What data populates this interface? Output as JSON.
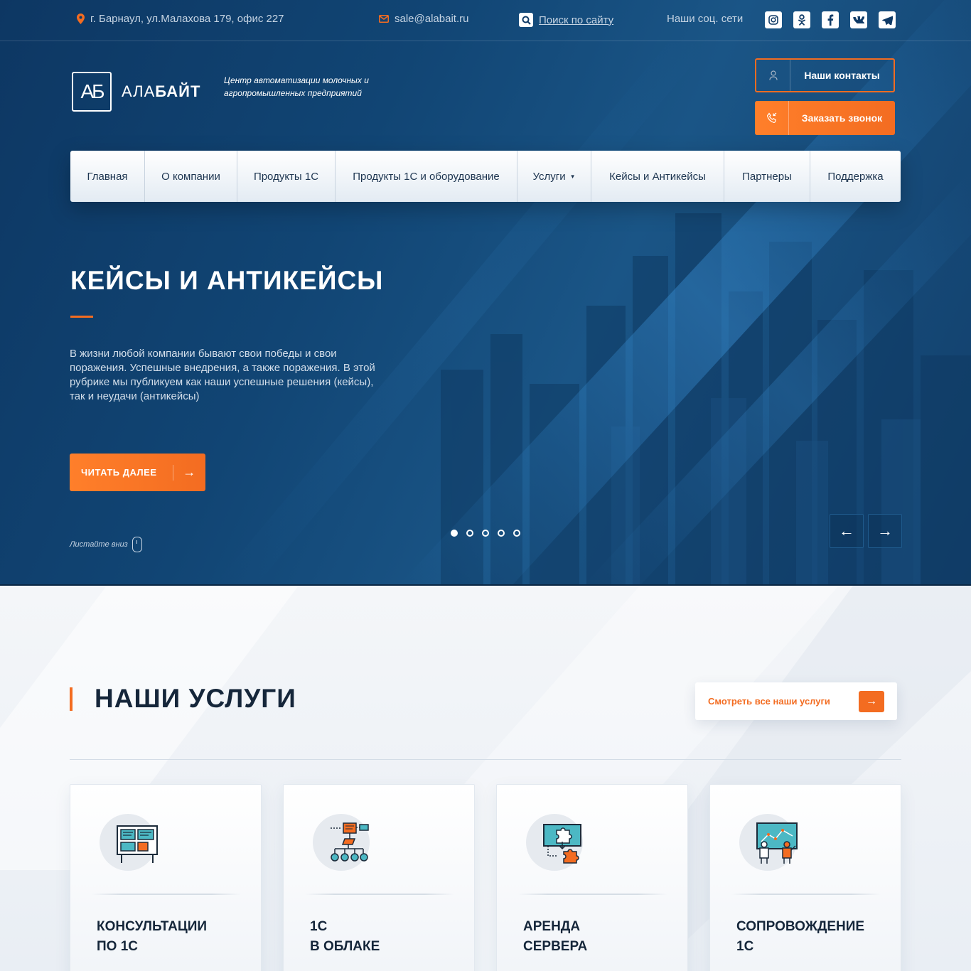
{
  "topbar": {
    "address": "г. Барнаул, ул.Малахова 179, офис 227",
    "email": "sale@alabait.ru",
    "search_link": "Поиск по сайту",
    "social_label": "Наши соц. сети",
    "socials": [
      "instagram-icon",
      "odnoklassniki-icon",
      "facebook-icon",
      "vk-icon",
      "telegram-icon"
    ]
  },
  "header": {
    "logo_mark": "АБ",
    "logo_light": "АЛА",
    "logo_bold": "БАЙТ",
    "tagline": "Центр автоматизации молочных и агропромышленных предприятий",
    "contacts_button": "Наши контакты",
    "call_button": "Заказать звонок"
  },
  "nav": {
    "items": [
      {
        "label": "Главная"
      },
      {
        "label": "О компании"
      },
      {
        "label": "Продукты 1С"
      },
      {
        "label": "Продукты 1С и оборудование"
      },
      {
        "label": "Услуги"
      },
      {
        "label": "Кейсы и Антикейсы"
      },
      {
        "label": "Партнеры"
      },
      {
        "label": "Поддержка"
      }
    ]
  },
  "hero": {
    "title": "КЕЙСЫ И АНТИКЕЙСЫ",
    "text": "В жизни любой компании бывают свои победы и свои поражения. Успешные внедрения, а также поражения. В этой рубрике мы публикуем как наши успешные решения (кейсы), так и неудачи (антикейсы)",
    "read_more": "ЧИТАТЬ ДАЛЕЕ",
    "scroll_hint": "Листайте вниз",
    "slides_count": 5,
    "active_slide": 1
  },
  "services": {
    "title": "НАШИ УСЛУГИ",
    "all_button": "Смотреть все наши услуги",
    "cards": [
      {
        "line1": "КОНСУЛЬТАЦИИ",
        "line2": "ПО 1С",
        "icon": "consulting-icon"
      },
      {
        "line1": "1С",
        "line2": "В ОБЛАКЕ",
        "icon": "cloud-network-icon"
      },
      {
        "line1": "АРЕНДА",
        "line2": "СЕРВЕРА",
        "icon": "server-puzzle-icon"
      },
      {
        "line1": "СОПРОВОЖДЕНИЕ",
        "line2": "1С",
        "icon": "support-presentation-icon"
      }
    ]
  },
  "colors": {
    "accent": "#f36c21",
    "hero_bg": "#114574",
    "dark_text": "#15263a"
  }
}
